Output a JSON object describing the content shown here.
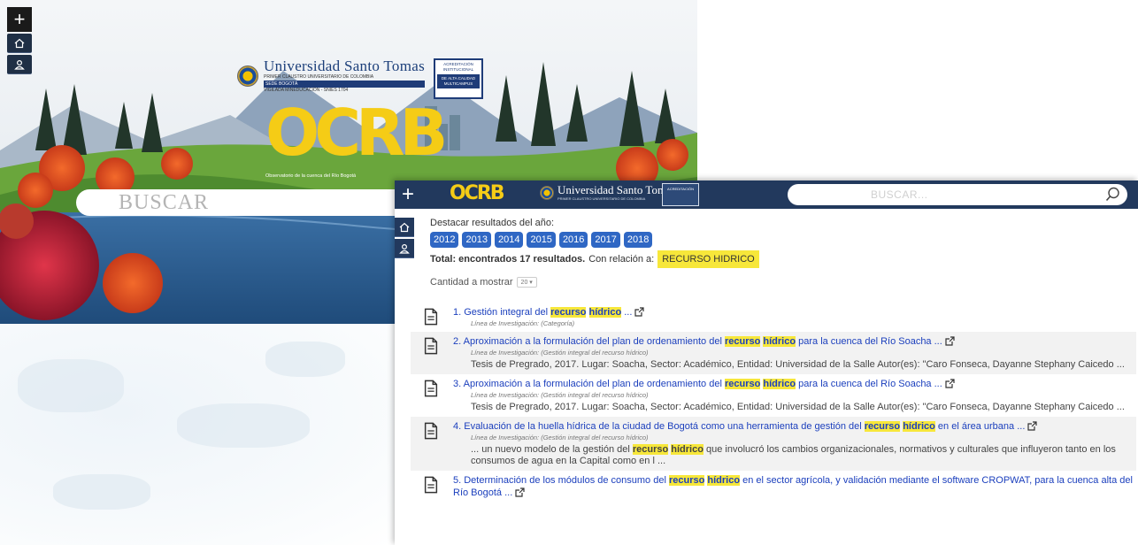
{
  "hero": {
    "university_name": "Universidad Santo Tomas",
    "university_sub": "PRIMER CLAUSTRO UNIVERSITARIO DE COLOMBIA",
    "university_bar": "SEDE BOGOTÁ",
    "university_sub2": "VIGILADA MINEDUCACIÓN - SNIES 1704",
    "acreditacion_title": "ACREDITACIÓN INSTITUCIONAL",
    "acreditacion_body": "DE ALTA CALIDAD MULTICAMPUS",
    "brand": "OCRB",
    "observatorio": "Observatorio de la cuenca del Río Bogotá",
    "search_placeholder": "BUSCAR"
  },
  "topbar": {
    "brand": "OCRB",
    "university_name": "Universidad Santo Tomas",
    "university_sub": "PRIMER CLAUSTRO UNIVERSITARIO DE COLOMBIA",
    "acreditacion": "ACREDITACIÓN",
    "search_placeholder": "BUSCAR..."
  },
  "content": {
    "highlight_label": "Destacar resultados del año:",
    "years": [
      "2012",
      "2013",
      "2014",
      "2015",
      "2016",
      "2017",
      "2018"
    ],
    "total_text": "Total: encontrados 17 resultados.",
    "relation_text": "Con relación a:",
    "query": "RECURSO HIDRICO",
    "quantity_label": "Cantidad a mostrar",
    "quantity_value": "20"
  },
  "results": [
    {
      "pre": "1. Gestión integral del ",
      "hl1": "recurso",
      "hl2": "hídrico",
      "post": " ...",
      "line": "Línea de Investigación: (Categoría)",
      "desc": ""
    },
    {
      "pre": "2. Aproximación a la formulación del plan de ordenamiento del ",
      "hl1": "recurso",
      "hl2": "hídrico",
      "post": " para la cuenca del Río Soacha ...",
      "line": "Línea de Investigación: (Gestión integral del recurso hídrico)",
      "desc": "Tesis de Pregrado, 2017. Lugar: Soacha, Sector: Académico, Entidad: Universidad de la Salle Autor(es): \"Caro Fonseca, Dayanne Stephany Caicedo ..."
    },
    {
      "pre": "3. Aproximación a la formulación del plan de ordenamiento del ",
      "hl1": "recurso",
      "hl2": "hídrico",
      "post": " para la cuenca del Río Soacha ...",
      "line": "Línea de Investigación: (Gestión integral del recurso hídrico)",
      "desc": "Tesis de Pregrado, 2017. Lugar: Soacha, Sector: Académico, Entidad: Universidad de la Salle Autor(es): \"Caro Fonseca, Dayanne Stephany Caicedo ..."
    },
    {
      "pre": "4. Evaluación de la huella hídrica de la ciudad de Bogotá como una herramienta de gestión del ",
      "hl1": "recurso",
      "hl2": "hídrico",
      "post": " en el área urbana ...",
      "line": "Línea de Investigación: (Gestión integral del recurso hídrico)",
      "desc_pre": "... un nuevo modelo de la gestión del ",
      "desc_hl1": "recurso",
      "desc_hl2": "hídrico",
      "desc_post": " que involucró los cambios organizacionales, normativos y culturales que influyeron tanto en los consumos de agua en la Capital como en l ..."
    },
    {
      "pre": "5. Determinación de los módulos de consumo del ",
      "hl1": "recurso",
      "hl2": "hídrico",
      "post": " en el sector agrícola, y validación mediante el software CROPWAT, para la cuenca alta del Río Bogotá ...",
      "line": "",
      "desc": ""
    }
  ],
  "colors": {
    "navy": "#22395d",
    "year_blue": "#2f67c4",
    "highlight_yellow": "#f7e73a",
    "brand_yellow": "#f5cc16",
    "link_blue": "#1b3fbd"
  }
}
